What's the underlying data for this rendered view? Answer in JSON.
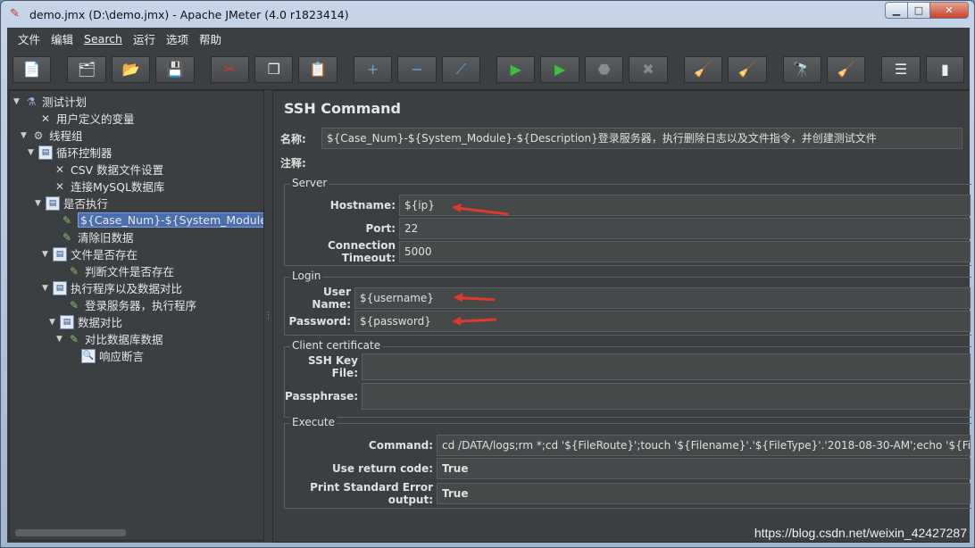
{
  "window": {
    "title": "demo.jmx (D:\\demo.jmx) - Apache JMeter (4.0 r1823414)",
    "controls": {
      "minimize": "▁",
      "maximize": "□",
      "close": "✕"
    }
  },
  "menu": [
    "文件",
    "编辑",
    "Search",
    "运行",
    "选项",
    "帮助"
  ],
  "toolbar": {
    "buttons": [
      {
        "icon": "new-icon",
        "glyph": "📄"
      },
      {
        "icon": "templates-icon",
        "glyph": "🗂"
      },
      {
        "icon": "open-icon",
        "glyph": "📂"
      },
      {
        "icon": "save-icon",
        "glyph": "💾"
      },
      {
        "icon": "cut-icon",
        "glyph": "✂"
      },
      {
        "icon": "copy-icon",
        "glyph": "❐"
      },
      {
        "icon": "paste-icon",
        "glyph": "📋"
      },
      {
        "icon": "expand-icon",
        "glyph": "+"
      },
      {
        "icon": "collapse-icon",
        "glyph": "−"
      },
      {
        "icon": "toggle-icon",
        "glyph": "⟋"
      },
      {
        "icon": "start-icon",
        "glyph": "▶"
      },
      {
        "icon": "start-no-pause-icon",
        "glyph": "▶"
      },
      {
        "icon": "stop-icon",
        "glyph": "⬣"
      },
      {
        "icon": "shutdown-icon",
        "glyph": "✖"
      },
      {
        "icon": "clear-icon",
        "glyph": "🧹"
      },
      {
        "icon": "clear-all-icon",
        "glyph": "🧹"
      },
      {
        "icon": "search-icon",
        "glyph": "🔭"
      },
      {
        "icon": "reset-search-icon",
        "glyph": "🧹"
      },
      {
        "icon": "function-helper-icon",
        "glyph": "☰"
      },
      {
        "icon": "help-icon",
        "glyph": "▮"
      }
    ]
  },
  "tree": {
    "nodes": [
      {
        "label": "测试计划",
        "icon": "test-plan-icon",
        "glyph": "⚗",
        "toggle": "▼"
      },
      {
        "label": "用户定义的变量",
        "icon": "config-wrench-icon",
        "glyph": "✕",
        "toggle": ""
      },
      {
        "label": "线程组",
        "icon": "thread-group-gear-icon",
        "glyph": "⚙",
        "toggle": "▼"
      },
      {
        "label": "循环控制器",
        "icon": "controller-icon",
        "glyph": "▤",
        "toggle": "▼"
      },
      {
        "label": "CSV 数据文件设置",
        "icon": "config-wrench-icon",
        "glyph": "✕",
        "toggle": ""
      },
      {
        "label": "连接MySQL数据库",
        "icon": "config-wrench-icon",
        "glyph": "✕",
        "toggle": ""
      },
      {
        "label": "是否执行",
        "icon": "controller-icon",
        "glyph": "▤",
        "toggle": "▼"
      },
      {
        "label": "${Case_Num}-${System_Module}-${Description}",
        "icon": "sampler-pipette-icon",
        "glyph": "✎",
        "toggle": "",
        "selected": true
      },
      {
        "label": "清除旧数据",
        "icon": "sampler-pipette-icon",
        "glyph": "✎",
        "toggle": ""
      },
      {
        "label": "文件是否存在",
        "icon": "controller-icon",
        "glyph": "▤",
        "toggle": "▼"
      },
      {
        "label": "判断文件是否存在",
        "icon": "sampler-pipette-icon",
        "glyph": "✎",
        "toggle": ""
      },
      {
        "label": "执行程序以及数据对比",
        "icon": "controller-icon",
        "glyph": "▤",
        "toggle": "▼"
      },
      {
        "label": "登录服务器，执行程序",
        "icon": "sampler-pipette-icon",
        "glyph": "✎",
        "toggle": ""
      },
      {
        "label": "数据对比",
        "icon": "controller-icon",
        "glyph": "▤",
        "toggle": "▼"
      },
      {
        "label": "对比数据库数据",
        "icon": "sampler-pipette-icon",
        "glyph": "✎",
        "toggle": "▼"
      },
      {
        "label": "响应断言",
        "icon": "assertion-icon",
        "glyph": "🔍",
        "toggle": ""
      }
    ]
  },
  "panel": {
    "title": "SSH Command",
    "name_label": "名称:",
    "name_value": "${Case_Num}-${System_Module}-${Description}登录服务器，执行删除日志以及文件指令，并创建测试文件",
    "comment_label": "注释:",
    "comment_value": "",
    "server": {
      "title": "Server",
      "hostname_label": "Hostname:",
      "hostname_value": "${ip}",
      "port_label": "Port:",
      "port_value": "22",
      "timeout_label": "Connection Timeout:",
      "timeout_value": "5000"
    },
    "login": {
      "title": "Login",
      "username_label": "User Name:",
      "username_value": "${username}",
      "password_label": "Password:",
      "password_value": "${password}"
    },
    "client_cert": {
      "title": "Client certificate",
      "keyfile_label": "SSH Key File:",
      "keyfile_value": "",
      "passphrase_label": "Passphrase:",
      "passphrase_value": ""
    },
    "execute": {
      "title": "Execute",
      "command_label": "Command:",
      "command_value": "cd /DATA/logs;rm *;cd '${FileRoute}';touch '${Filename}'.'${FileType}'.'2018-08-30-AM';echo '${FileContent}'>>'${",
      "return_code_label": "Use return code:",
      "return_code_value": "True",
      "stderr_label": "Print Standard Error output:",
      "stderr_value": "True"
    }
  },
  "watermark": "https://blog.csdn.net/weixin_42427287",
  "colors": {
    "background": "#3c3f41",
    "selection": "#4b6eaf",
    "arrow": "#e0392b"
  }
}
